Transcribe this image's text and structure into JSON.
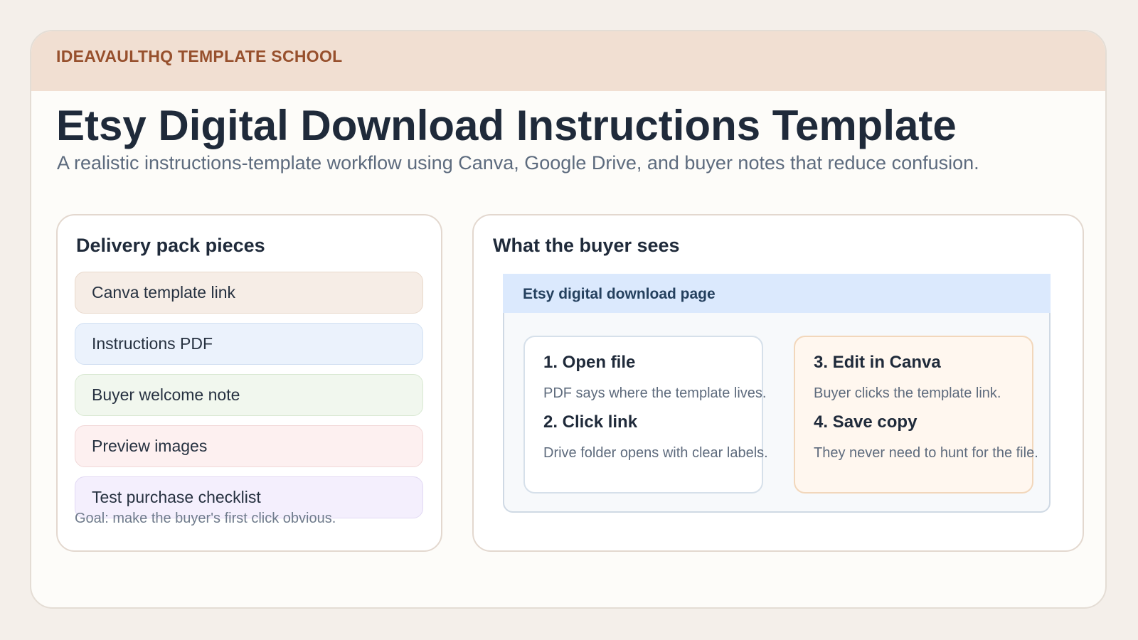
{
  "header": {
    "brand": "IDEAVAULTHQ TEMPLATE SCHOOL",
    "title": "Etsy Digital Download Instructions Template",
    "subtitle": "A realistic instructions-template workflow using Canva, Google Drive, and buyer notes that reduce confusion."
  },
  "delivery_pack": {
    "title": "Delivery pack pieces",
    "items": [
      {
        "label": "Canva template link",
        "color": "#f6ede6"
      },
      {
        "label": "Instructions PDF",
        "color": "#ebf2fc"
      },
      {
        "label": "Buyer welcome note",
        "color": "#f1f7ee"
      },
      {
        "label": "Preview images",
        "color": "#fdf0f0"
      },
      {
        "label": "Test purchase checklist",
        "color": "#f4effd"
      }
    ],
    "goal": "Goal: make the buyer's first click obvious."
  },
  "buyer_view": {
    "title": "What the buyer sees",
    "page_label": "Etsy digital download page",
    "left_card": {
      "step1_title": "1. Open file",
      "step1_desc": "PDF says where the template lives.",
      "step2_title": "2. Click link",
      "step2_desc": "Drive folder opens with clear labels."
    },
    "right_card": {
      "step3_title": "3. Edit in Canva",
      "step3_desc": "Buyer clicks the template link.",
      "step4_title": "4. Save copy",
      "step4_desc": "They never need to hunt for the file."
    }
  }
}
